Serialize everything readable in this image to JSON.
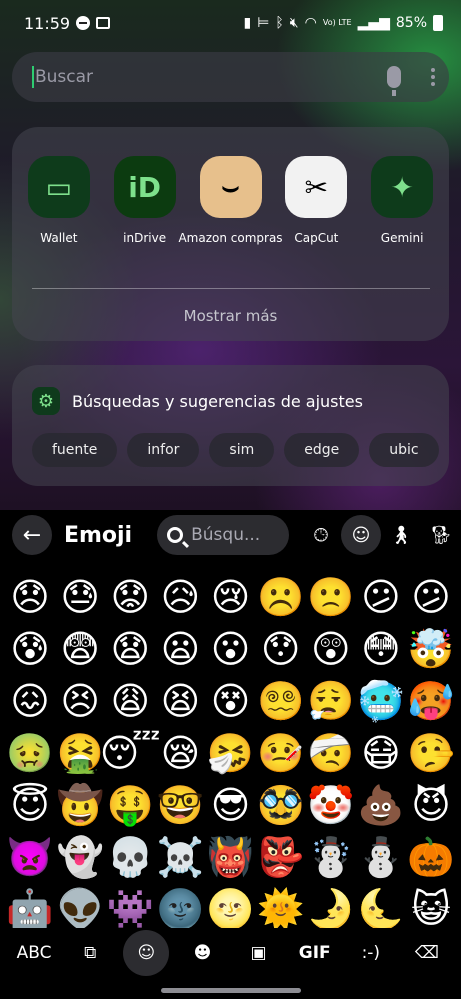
{
  "status_bar": {
    "time": "11:59",
    "signal_text": "Vo) LTE",
    "battery": "85%"
  },
  "search": {
    "placeholder": "Buscar"
  },
  "apps": [
    {
      "label": "Wallet",
      "icon": "wallet-icon",
      "bg": "#0e3b1b",
      "glyph": "▭"
    },
    {
      "label": "inDrive",
      "icon": "indrive-icon",
      "bg": "#0c3b10",
      "glyph": "iD"
    },
    {
      "label": "Amazon compras",
      "icon": "amazon-icon",
      "bg": "#e7c08c",
      "glyph": "⌣"
    },
    {
      "label": "CapCut",
      "icon": "capcut-icon",
      "bg": "#f2f2f2",
      "glyph": "✂"
    },
    {
      "label": "Gemini",
      "icon": "gemini-icon",
      "bg": "#0e3b1b",
      "glyph": "✦"
    }
  ],
  "show_more": "Mostrar más",
  "settings": {
    "title": "Búsquedas y sugerencias de ajustes",
    "chips": [
      "fuente",
      "infor",
      "sim",
      "edge",
      "ubic",
      ""
    ]
  },
  "keyboard": {
    "title": "Emoji",
    "search_placeholder": "Búsqu...",
    "bottom": {
      "abc": "ABC",
      "gif": "GIF",
      "emoticon": ":-)"
    },
    "emoji_rows": [
      [
        "😞",
        "😓",
        "😟",
        "😥",
        "😢",
        "☹️",
        "🙁",
        "😕",
        "😕"
      ],
      [
        "😰",
        "😨",
        "😧",
        "😦",
        "😮",
        "😯",
        "😲",
        "😳",
        "🤯"
      ],
      [
        "😖",
        "😣",
        "😩",
        "😫",
        "😵",
        "😵‍💫",
        "😮‍💨",
        "🥶",
        "🥵"
      ],
      [
        "🤢",
        "🤮",
        "😴",
        "😪",
        "🤧",
        "🤒",
        "🤕",
        "😷",
        "🤥"
      ],
      [
        "😇",
        "🤠",
        "🤑",
        "🤓",
        "😎",
        "🥸",
        "🤡",
        "💩",
        "😈"
      ],
      [
        "👿",
        "👻",
        "💀",
        "☠️",
        "👹",
        "👺",
        "☃️",
        "⛄",
        "🎃"
      ],
      [
        "🤖",
        "👽",
        "👾",
        "🌚",
        "🌝",
        "🌞",
        "🌛",
        "🌜",
        "😺"
      ]
    ]
  }
}
